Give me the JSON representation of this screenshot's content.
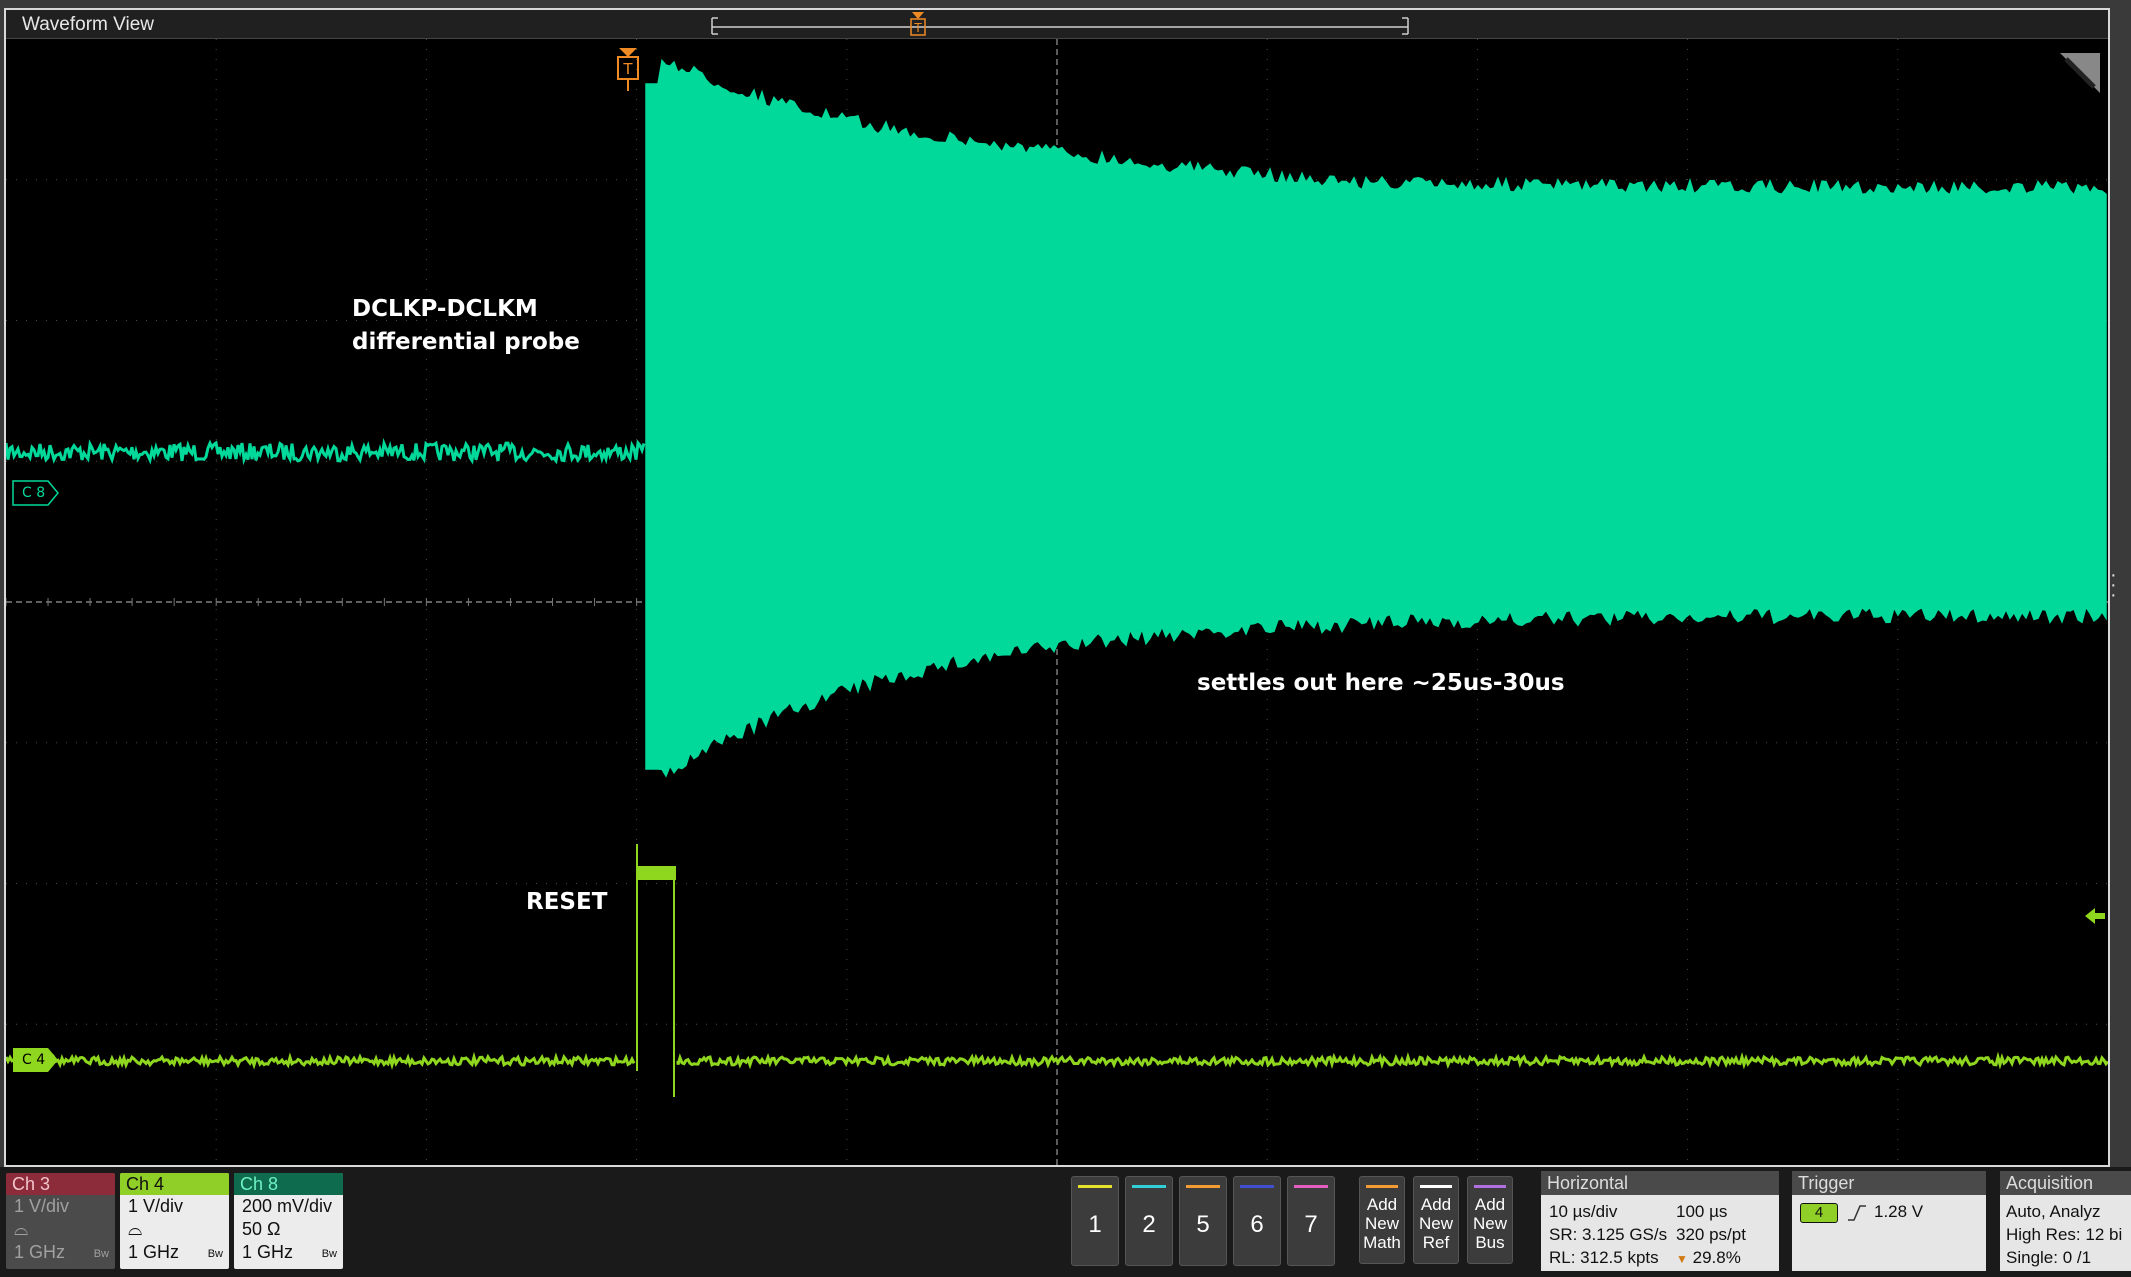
{
  "window": {
    "title": "Waveform View"
  },
  "markers": {
    "trigger_top": "T",
    "trigger_plot": "T",
    "ch8": "C 8",
    "ch4": "C 4"
  },
  "annotations": {
    "probe_line1": "DCLKP-DCLKM",
    "probe_line2": "differential probe",
    "reset": "RESET",
    "settle": "settles out here ~25us-30us"
  },
  "channels": [
    {
      "header": "Ch 3",
      "scale": "1 V/div",
      "bandwidth": "1 GHz",
      "bw_mark": "Bw",
      "state": "off"
    },
    {
      "header": "Ch 4",
      "scale": "1 V/div",
      "bandwidth": "1 GHz",
      "bw_mark": "Bw",
      "state": "on"
    },
    {
      "header": "Ch 8",
      "scale": "200 mV/div",
      "termination": "50 Ω",
      "bandwidth": "1 GHz",
      "bw_mark": "Bw",
      "state": "on"
    }
  ],
  "slot_buttons": [
    {
      "label": "1",
      "color": "#e6e12b"
    },
    {
      "label": "2",
      "color": "#33cfd8"
    },
    {
      "label": "5",
      "color": "#f29c33"
    },
    {
      "label": "6",
      "color": "#3f4fd0"
    },
    {
      "label": "7",
      "color": "#e35fc0"
    }
  ],
  "add_buttons": [
    {
      "line1": "Add",
      "line2": "New",
      "line3": "Math",
      "color": "#f29c33"
    },
    {
      "line1": "Add",
      "line2": "New",
      "line3": "Ref",
      "color": "#ffffff"
    },
    {
      "line1": "Add",
      "line2": "New",
      "line3": "Bus",
      "color": "#b070e0"
    }
  ],
  "horizontal": {
    "title": "Horizontal",
    "scale": "10 µs/div",
    "position": "100 µs",
    "sample_rate": "SR: 3.125 GS/s",
    "resolution": "320 ps/pt",
    "record_length": "RL: 312.5 kpts",
    "trigger_pos": "29.8%"
  },
  "trigger": {
    "title": "Trigger",
    "source": "4",
    "level": "1.28 V",
    "slope": "rising"
  },
  "acquisition": {
    "title": "Acquisition",
    "line1": "Auto,    Analyz",
    "line2": "High Res: 12 bi",
    "line3": "Single: 0 /1"
  },
  "colors": {
    "ch8": "#00d99a",
    "ch4": "#8fd61f",
    "trigger": "#f08a24",
    "grid": "#555555"
  }
}
